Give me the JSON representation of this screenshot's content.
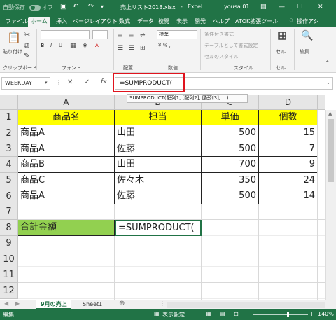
{
  "titlebar": {
    "autosave": "自動保存",
    "autosave_state": "オフ",
    "filename": "売上リスト2018.xlsx",
    "app": "Excel",
    "user": "yousa 01",
    "restore_icon": "ribbon-display-icon",
    "minimize": "—",
    "maximize": "☐",
    "close": "✕"
  },
  "tabs": [
    "ファイル",
    "ホーム",
    "挿入",
    "ページレイアウト",
    "数式",
    "データ",
    "校閲",
    "表示",
    "開発",
    "ヘルプ",
    "ATOK拡張ツール"
  ],
  "tell_me": "操作アシ",
  "ribbon": {
    "paste": "貼り付け",
    "clipboard": "クリップボード",
    "font": "フォント",
    "align": "配置",
    "number_format": "標準",
    "number": "数値",
    "cond_format": "条件付き書式",
    "table_format": "テーブルとして書式設定",
    "cell_style": "セルのスタイル",
    "styles": "スタイル",
    "cells": "セル",
    "cells_btn": "セル",
    "edit": "編集"
  },
  "formula_bar": {
    "name_box": "WEEKDAY",
    "cancel": "✕",
    "enter": "✓",
    "fx": "fx",
    "formula": "=SUMPRODUCT(",
    "tooltip": "SUMPRODUCT(配列1, [配列2], [配列3], ...)"
  },
  "columns": [
    "A",
    "B",
    "C",
    "D"
  ],
  "rows": [
    "1",
    "2",
    "3",
    "4",
    "5",
    "6",
    "7",
    "8",
    "9",
    "10",
    "11",
    "12",
    "13"
  ],
  "table": {
    "header": [
      "商品名",
      "担当",
      "単価",
      "個数"
    ],
    "data": [
      [
        "商品A",
        "山田",
        "500",
        "15"
      ],
      [
        "商品A",
        "佐藤",
        "500",
        "7"
      ],
      [
        "商品B",
        "山田",
        "700",
        "9"
      ],
      [
        "商品C",
        "佐々木",
        "350",
        "24"
      ],
      [
        "商品A",
        "佐藤",
        "500",
        "14"
      ]
    ]
  },
  "total_label": "合計金額",
  "total_formula": "=SUMPRODUCT(",
  "sheets": [
    "9月の売上",
    "Sheet1"
  ],
  "add_sheet": "⊕",
  "status": {
    "mode": "編集",
    "display_settings": "表示設定",
    "zoom": "140%"
  },
  "colors": {
    "brand": "#217346",
    "header_fill": "#ffff00",
    "total_fill": "#92d050",
    "highlight_border": "#e0141e"
  }
}
